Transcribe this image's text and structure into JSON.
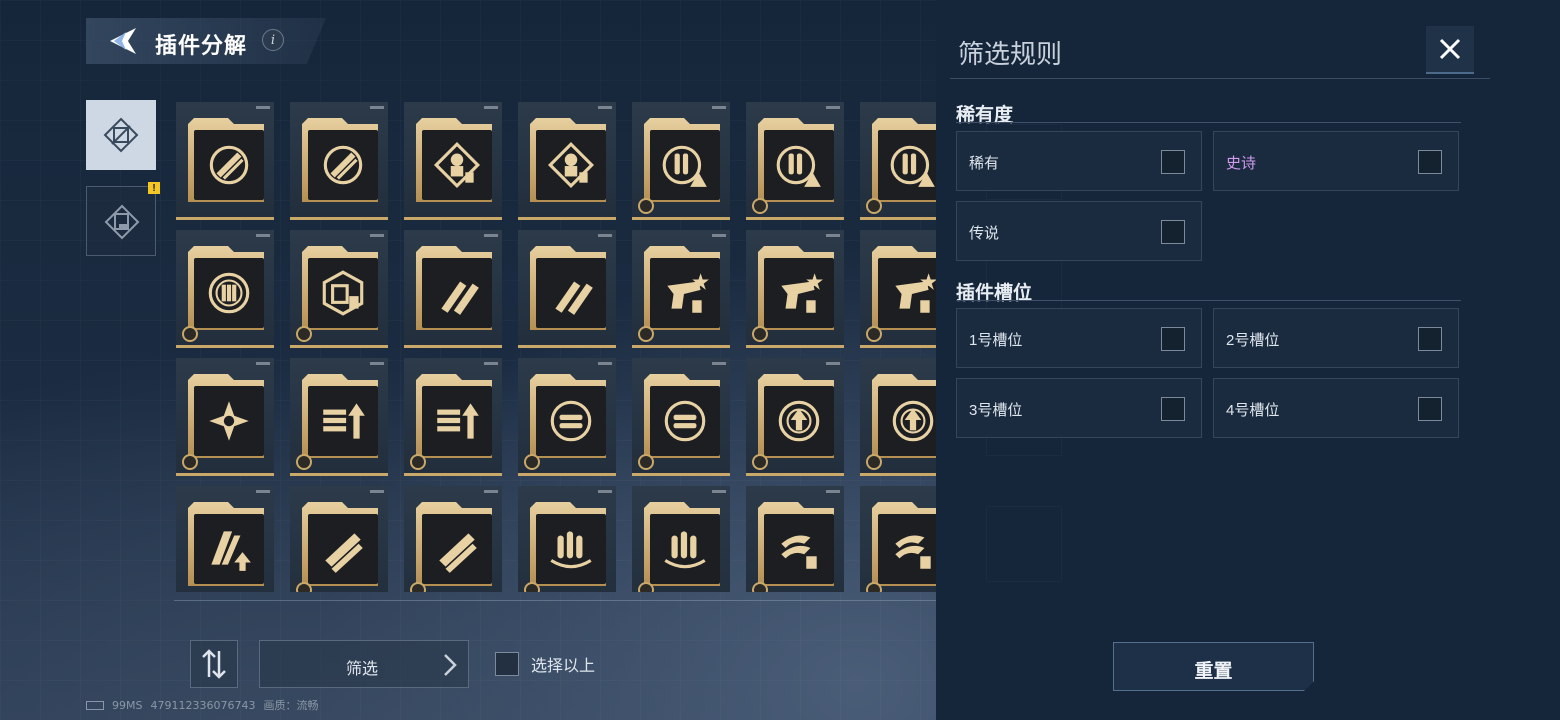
{
  "header": {
    "title": "插件分解",
    "info_icon": "i"
  },
  "categories": [
    {
      "icon": "plugin-core-icon",
      "active": true
    },
    {
      "icon": "plugin-secondary-icon",
      "active": false,
      "alert": "!"
    }
  ],
  "plugins": [
    {
      "icon": "missile-target-icon",
      "badge": false
    },
    {
      "icon": "missile-target-icon",
      "badge": false
    },
    {
      "icon": "sniper-crosshair-icon",
      "badge": false
    },
    {
      "icon": "sniper-crosshair-icon",
      "badge": false
    },
    {
      "icon": "ammo-warning-icon",
      "badge": true
    },
    {
      "icon": "ammo-warning-icon",
      "badge": true
    },
    {
      "icon": "ammo-warning-icon",
      "badge": true
    },
    {
      "icon": "triple-ammo-target-icon",
      "badge": true
    },
    {
      "icon": "magazine-hex-icon",
      "badge": true
    },
    {
      "icon": "twin-bullets-icon",
      "badge": false
    },
    {
      "icon": "twin-bullets-icon",
      "badge": false
    },
    {
      "icon": "pistol-star-icon",
      "badge": true
    },
    {
      "icon": "pistol-star-icon",
      "badge": true
    },
    {
      "icon": "pistol-star-icon",
      "badge": true
    },
    {
      "icon": "cross-star-icon",
      "badge": true
    },
    {
      "icon": "bullets-up-icon",
      "badge": true
    },
    {
      "icon": "bullets-up-icon",
      "badge": true
    },
    {
      "icon": "reload-cycle-icon",
      "badge": true
    },
    {
      "icon": "reload-cycle-icon",
      "badge": true
    },
    {
      "icon": "target-up-icon",
      "badge": true
    },
    {
      "icon": "target-up-icon",
      "badge": true
    },
    {
      "icon": "belt-up-icon",
      "badge": false
    },
    {
      "icon": "twin-rockets-icon",
      "badge": true
    },
    {
      "icon": "twin-rockets-icon",
      "badge": true
    },
    {
      "icon": "bullets-spin-icon",
      "badge": true
    },
    {
      "icon": "bullets-spin-icon",
      "badge": true
    },
    {
      "icon": "claw-ammo-icon",
      "badge": true
    },
    {
      "icon": "claw-ammo-icon",
      "badge": true
    }
  ],
  "controls": {
    "sort_icon": "sort-arrows-icon",
    "filter_label": "筛选",
    "select_above_label": "选择以上"
  },
  "status": {
    "ping": "99MS",
    "uid": "479112336076743",
    "quality": "画质：流畅"
  },
  "filter_panel": {
    "title": "筛选规则",
    "close_icon": "close-icon",
    "rarity_heading": "稀有度",
    "rarity_options": [
      {
        "label": "稀有",
        "color": "#dfe5ec",
        "checked": false
      },
      {
        "label": "史诗",
        "color": "#d39bf0",
        "checked": false
      },
      {
        "label": "传说",
        "color": "#dfe5ec",
        "checked": false
      }
    ],
    "slot_heading": "插件槽位",
    "slot_options": [
      {
        "label": "1号槽位",
        "checked": false
      },
      {
        "label": "2号槽位",
        "checked": false
      },
      {
        "label": "3号槽位",
        "checked": false
      },
      {
        "label": "4号槽位",
        "checked": false
      }
    ],
    "reset_label": "重置"
  },
  "colors": {
    "accent_gold": "#c9a86a",
    "panel_bg": "#16263a",
    "epic": "#d39bf0"
  }
}
